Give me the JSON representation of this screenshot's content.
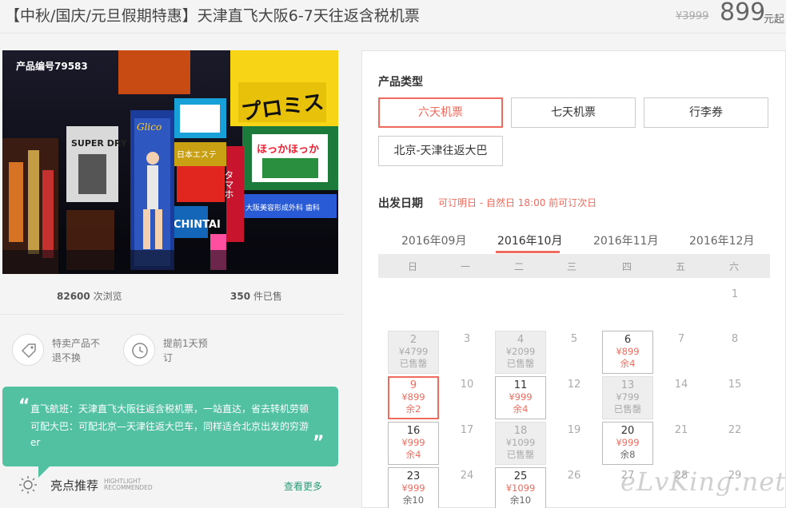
{
  "header": {
    "title": "【中秋/国庆/元旦假期特惠】天津直飞大阪6-7天往返含税机票",
    "old_price": "¥3999",
    "price": "899",
    "price_unit": "元起"
  },
  "product": {
    "id_label": "产品编号79583",
    "image_signs": [
      "プロミス",
      "ほっかほっか",
      "CHINTAI",
      "大阪美容形成外科 歯科",
      "SUPER DRY",
      "Glico",
      "タマホ",
      "日本エステ"
    ],
    "views_num": "82600",
    "views_label": "次浏览",
    "sold_num": "350",
    "sold_label": "件已售",
    "features": [
      {
        "icon": "tag-icon",
        "line1": "特卖产品不",
        "line2": "退不换"
      },
      {
        "icon": "clock-icon",
        "line1": "提前1天预",
        "line2": "订"
      }
    ]
  },
  "recommend": {
    "line1": "直飞航班：天津直飞大阪往返含税机票，一站直达，省去转机劳顿",
    "line2": "可配大巴：可配北京—天津往返大巴车，同样适合北京出发的穷游",
    "line3": "er",
    "quote_open": "“",
    "quote_close": "”",
    "title": "亮点推荐",
    "title_en_1": "HIGHTLIGHT",
    "title_en_2": "RECOMMENDED",
    "more": "查看更多"
  },
  "booking": {
    "type_label": "产品类型",
    "types": [
      "六天机票",
      "七天机票",
      "行李券",
      "北京-天津往返大巴"
    ],
    "selected_type": "六天机票",
    "date_label": "出发日期",
    "date_note": "可订明日 - 自然日 18:00 前可订次日",
    "months": [
      "2016年09月",
      "2016年10月",
      "2016年11月",
      "2016年12月"
    ],
    "selected_month": "2016年10月",
    "weekdays": [
      "日",
      "一",
      "二",
      "三",
      "四",
      "五",
      "六"
    ],
    "days": [
      {
        "d": "1"
      },
      {
        "d": "2",
        "price": "¥4799",
        "status": "已售罄",
        "sold": true
      },
      {
        "d": "3"
      },
      {
        "d": "4",
        "price": "¥2099",
        "status": "已售罄",
        "sold": true
      },
      {
        "d": "5"
      },
      {
        "d": "6",
        "price": "¥899",
        "status": "余4"
      },
      {
        "d": "7"
      },
      {
        "d": "8"
      },
      {
        "d": "9",
        "price": "¥899",
        "status": "余2",
        "selected": true
      },
      {
        "d": "10"
      },
      {
        "d": "11",
        "price": "¥999",
        "status": "余4"
      },
      {
        "d": "12"
      },
      {
        "d": "13",
        "price": "¥799",
        "status": "已售罄",
        "sold": true
      },
      {
        "d": "14"
      },
      {
        "d": "15"
      },
      {
        "d": "16",
        "price": "¥999",
        "status": "余4"
      },
      {
        "d": "17"
      },
      {
        "d": "18",
        "price": "¥1099",
        "status": "已售罄",
        "sold": true
      },
      {
        "d": "19"
      },
      {
        "d": "20",
        "price": "¥999",
        "status": "余8"
      },
      {
        "d": "21"
      },
      {
        "d": "22"
      },
      {
        "d": "23",
        "price": "¥999",
        "status": "余10"
      },
      {
        "d": "24"
      },
      {
        "d": "25",
        "price": "¥1099",
        "status": "余10"
      },
      {
        "d": "26"
      },
      {
        "d": "27"
      },
      {
        "d": "28"
      },
      {
        "d": "29"
      }
    ]
  },
  "watermark": "eLvKing.net"
}
